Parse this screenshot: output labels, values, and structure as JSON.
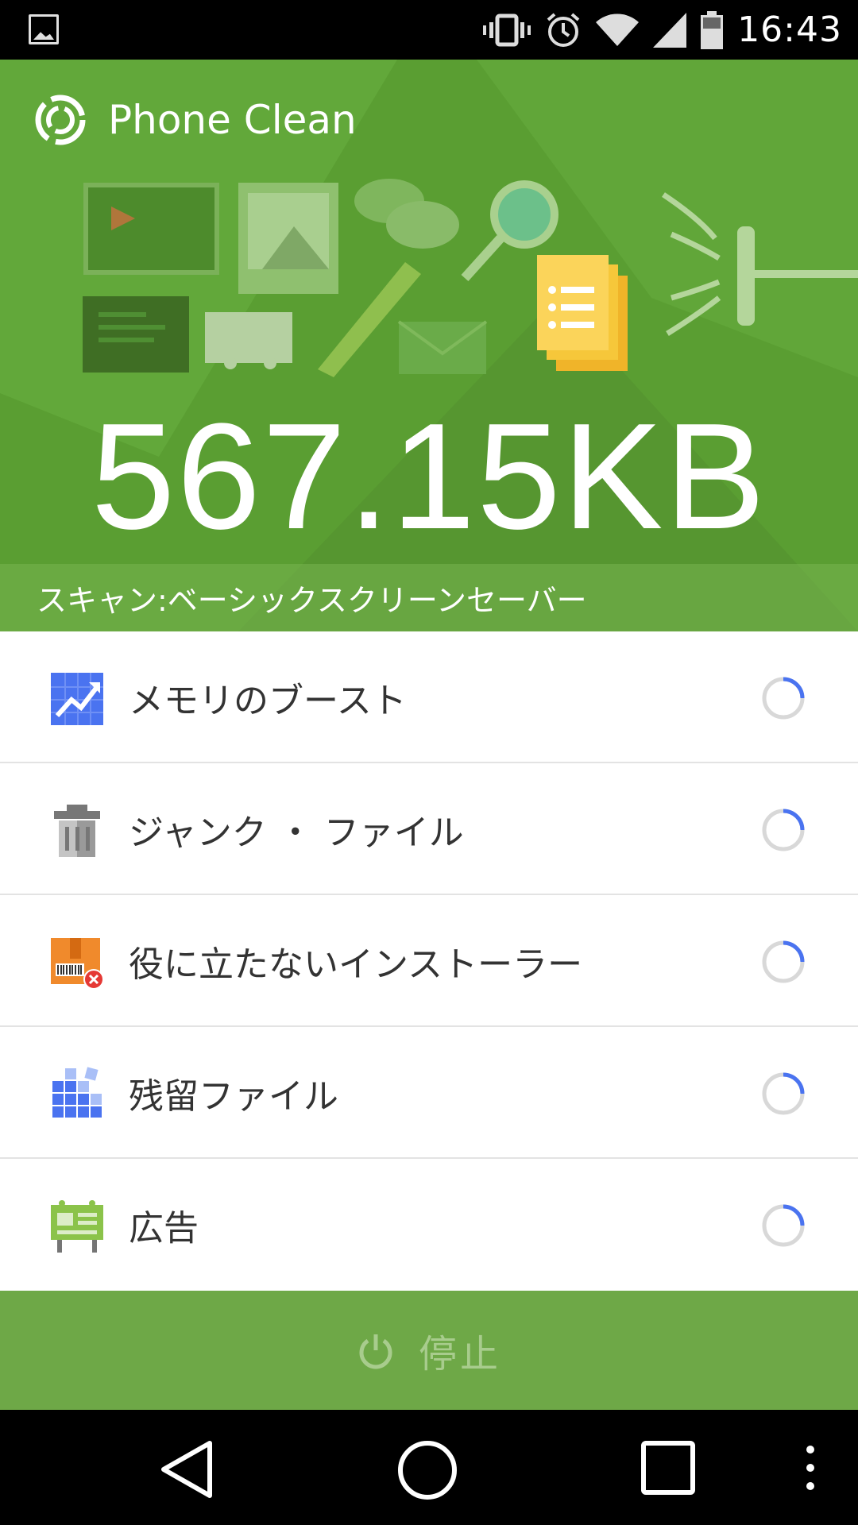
{
  "status_bar": {
    "time": "16:43",
    "icons": [
      "gallery-icon",
      "vibrate-icon",
      "alarm-icon",
      "wifi-icon",
      "signal-icon",
      "battery-icon"
    ]
  },
  "app": {
    "title": "Phone Clean",
    "scanned_size": "567.15KB",
    "scan_status": "スキャン:ベーシックスクリーンセーバー"
  },
  "scan_items": [
    {
      "label": "メモリのブースト",
      "icon": "memory-boost-icon"
    },
    {
      "label": "ジャンク ・ ファイル",
      "icon": "trash-icon"
    },
    {
      "label": "役に立たないインストーラー",
      "icon": "installer-package-icon"
    },
    {
      "label": "残留ファイル",
      "icon": "residual-files-icon"
    },
    {
      "label": "広告",
      "icon": "ad-board-icon"
    }
  ],
  "stop_button": {
    "label": "停止",
    "icon": "power-icon"
  },
  "navigation": [
    "back-icon",
    "home-icon",
    "recents-icon",
    "menu-icon"
  ],
  "colors": {
    "hero_green": "#5a9e32",
    "stop_green": "#6ea847",
    "spinner_blue": "#4a73f0"
  }
}
